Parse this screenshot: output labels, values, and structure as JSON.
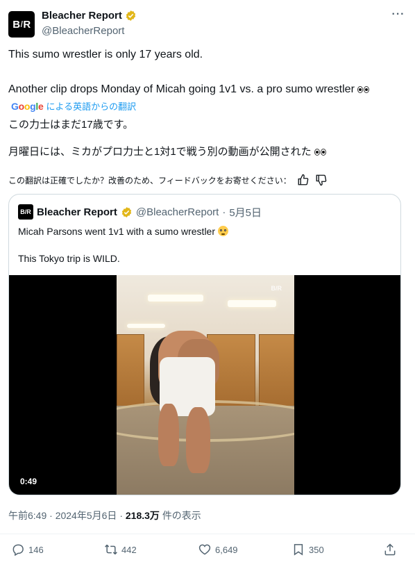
{
  "account": {
    "display_name": "Bleacher Report",
    "handle": "@BleacherReport",
    "avatar_text": "B/R",
    "verified": true
  },
  "tweet": {
    "line1": "This sumo wrestler is only 17 years old.",
    "line2": "Another clip drops Monday of Micah going 1v1 vs. a pro sumo wrestler",
    "google_logo": "Google",
    "translated_by": "による英語からの翻訳",
    "jp_line1": "この力士はまだ17歳です。",
    "jp_line2": "月曜日には、ミカがプロ力士と1対1で戦う別の動画が公開された",
    "feedback_prompt": "この翻訳は正確でしたか？改善のため、フィードバックをお寄せください："
  },
  "quoted": {
    "display_name": "Bleacher Report",
    "handle": "@BleacherReport",
    "date": "5月5日",
    "line1": "Micah Parsons went 1v1 with a sumo wrestler",
    "line2": "This Tokyo trip is WILD.",
    "video_time": "0:49",
    "watermark": "B/R"
  },
  "meta": {
    "time": "午前6:49",
    "date": "2024年5月6日",
    "views": "218.3万",
    "views_label": "件の表示"
  },
  "actions": {
    "replies": "146",
    "reposts": "442",
    "likes": "6,649",
    "bookmarks": "350"
  },
  "colors": {
    "verified_gold": "#e2b719",
    "link_blue": "#1d9bf0",
    "secondary_text": "#536471"
  }
}
